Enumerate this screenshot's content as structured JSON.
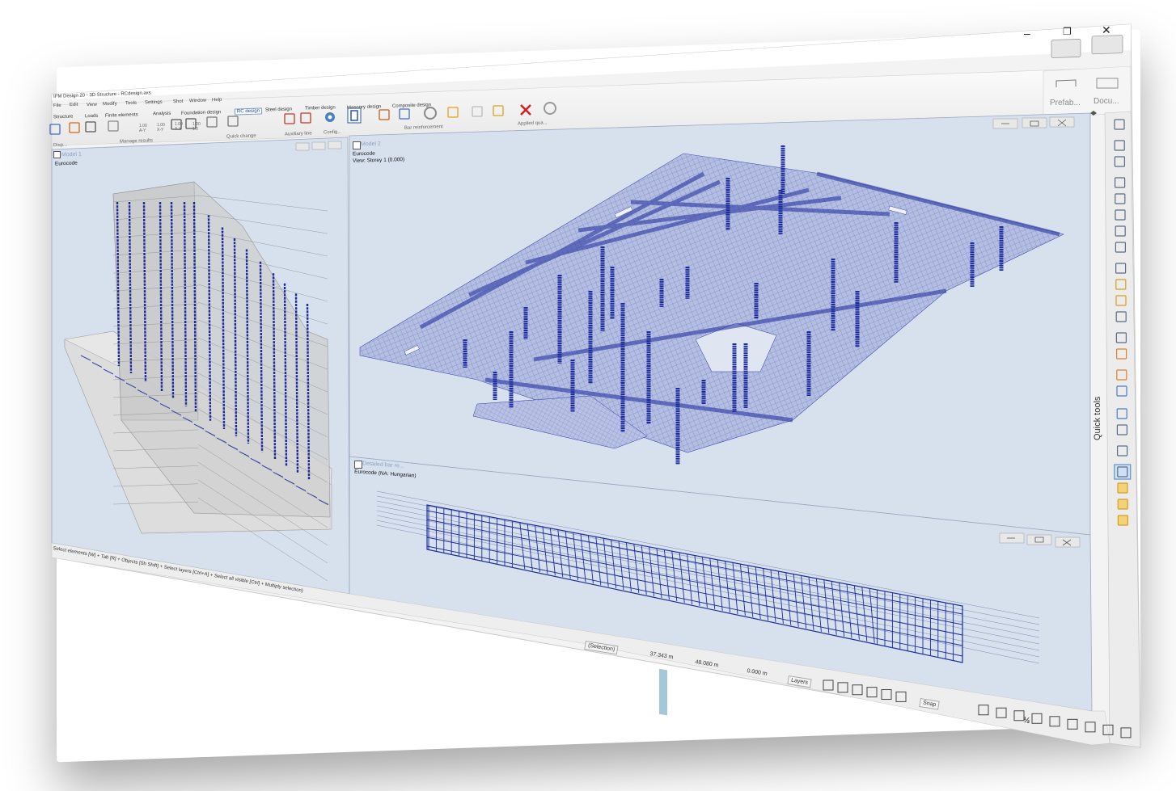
{
  "window": {
    "title": "IFM Design 20 - 3D Structure - RCdesign.axs",
    "minimize_glyph": "–",
    "restore_glyph": "❐",
    "close_glyph": "✕"
  },
  "menu": [
    "File",
    "Edit",
    "View",
    "Modify",
    "Tools",
    "Settings",
    "Shot",
    "Window",
    "Help"
  ],
  "tabs": [
    "Structure",
    "Loads",
    "Finite elements",
    "Analysis",
    "Foundation design",
    "RC design",
    "Steel design",
    "Timber design",
    "Masonry design",
    "Composite design"
  ],
  "active_tab": "RC design",
  "ribbon_groups": {
    "display": "Disp...",
    "manage_results": "Manage results",
    "quick_change": "Quick change",
    "auxiliary_line": "Auxiliary line",
    "config": "Config...",
    "bar_reinforcement": "Bar reinforcement",
    "applied_qua": "Applied qua..."
  },
  "ribbon_values": [
    "1.00 A-Y",
    "1.00 X-Y",
    "1.00 A-X",
    "1.00 1.0"
  ],
  "side_buttons": {
    "prefab": "Prefab...",
    "docu": "Docu..."
  },
  "views": {
    "model1": {
      "title": "Model 1",
      "info": [
        "Eurocode"
      ]
    },
    "model2": {
      "title": "Model 2",
      "info": [
        "Eurocode",
        "View: Storey 1 (0.000)"
      ]
    },
    "detail": {
      "title": "Detailed bar re...",
      "info": [
        "Eurocode (NA: Hungarian)"
      ]
    }
  },
  "status": {
    "hint": "Select elements [W] + Tab [R] + Objects [Sh Shift] + Select layers [Ctrl+A] + Select all visible [Ctrl] + Multiply selection)",
    "selection": "(Selection)",
    "x": "37.343 m",
    "y": "48.080 m",
    "z": "0.000 m",
    "layers": "Layers",
    "snap": "Snap",
    "half": "½"
  },
  "quick_tools_label": "Quick tools",
  "icons": [
    "undo-icon",
    "redo-icon",
    "zoom-icon",
    "settings-icon",
    "delete-icon",
    "refresh-icon"
  ],
  "colors": {
    "accent": "#2b33a6",
    "viewport_bg": "#d7e1ee",
    "ribbon_bg": "#f0f0f0"
  }
}
